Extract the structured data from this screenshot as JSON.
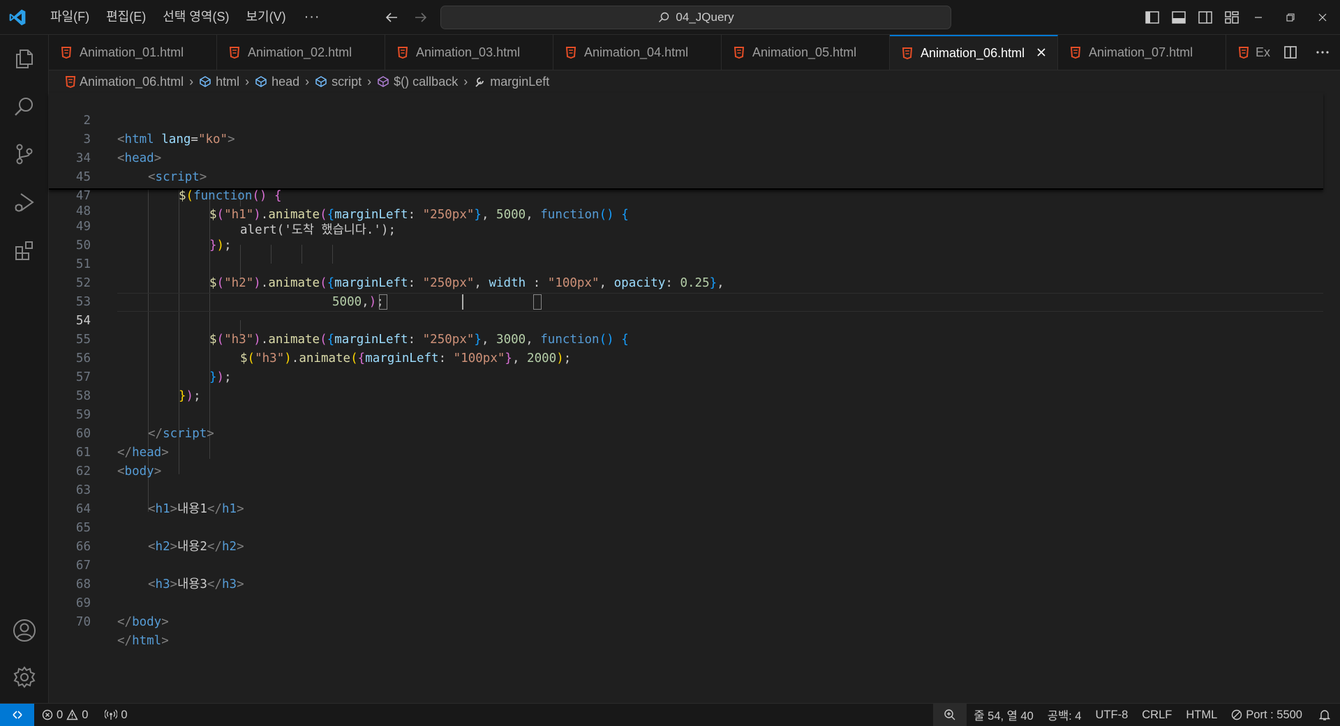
{
  "titlebar": {
    "menu": [
      "파일(F)",
      "편집(E)",
      "선택 영역(S)",
      "보기(V)"
    ],
    "more": "···",
    "search_text": "04_JQuery"
  },
  "tabs": [
    {
      "label": "Animation_01.html"
    },
    {
      "label": "Animation_02.html"
    },
    {
      "label": "Animation_03.html"
    },
    {
      "label": "Animation_04.html"
    },
    {
      "label": "Animation_05.html"
    },
    {
      "label": "Animation_06.html",
      "active": true
    },
    {
      "label": "Animation_07.html"
    }
  ],
  "tab_partial": "Ex",
  "breadcrumb": {
    "file": "Animation_06.html",
    "items": [
      "html",
      "head",
      "script",
      "$() callback",
      "marginLeft"
    ]
  },
  "sticky_lines": [
    "2",
    "3",
    "34",
    "45",
    "47"
  ],
  "line_numbers": [
    "48",
    "49",
    "50",
    "51",
    "52",
    "53",
    "54",
    "55",
    "56",
    "57",
    "58",
    "59",
    "60",
    "61",
    "62",
    "63",
    "64",
    "65",
    "66",
    "67",
    "68",
    "69",
    "70"
  ],
  "code": {
    "l2": {
      "lt": "<",
      "tag": "html",
      "attr": "lang",
      "eq": "=",
      "val": "\"ko\"",
      "gt": ">"
    },
    "l3": {
      "lt": "<",
      "tag": "head",
      "gt": ">"
    },
    "l34": {
      "lt": "<",
      "tag": "script",
      "gt": ">"
    },
    "l45": {
      "dollar": "$",
      "p1": "(",
      "kw": "function",
      "p2": "()",
      "sp": " ",
      "b": "{"
    },
    "l47": {
      "dollar": "$",
      "p1": "(",
      "sel": "\"h1\"",
      "p2": ")",
      "dot": ".",
      "fn": "animate",
      "p3": "(",
      "b1": "{",
      "prop": "marginLeft",
      "colon": ": ",
      "val": "\"250px\"",
      "b2": "}",
      "comma": ", ",
      "num": "5000",
      "comma2": ", ",
      "kw": "function",
      "p4": "()",
      "sp": " ",
      "b3": "{"
    },
    "l48": {
      "text": "alert('도착 했습니다.');"
    },
    "l49": {
      "b": "}",
      "p": ")",
      "semi": ";"
    },
    "l51": {
      "dollar": "$",
      "p1": "(",
      "sel": "\"h2\"",
      "p2": ")",
      "dot": ".",
      "fn": "animate",
      "p3": "(",
      "b1": "{",
      "prop": "marginLeft",
      "colon": ": ",
      "val": "\"250px\"",
      "comma": ", ",
      "prop2": "width",
      "colon2": " : ",
      "val2": "\"100px\"",
      "comma2": ", ",
      "prop3": "opacity",
      "colon3": ": ",
      "num3": "0.25",
      "b2": "}",
      "comma3": ","
    },
    "l52": {
      "num": "5000",
      "comma": ",",
      "p": ")",
      "semi": ";"
    },
    "l54": {
      "dollar": "$",
      "p1": "(",
      "sel": "\"h3\"",
      "p2": ")",
      "dot": ".",
      "fn": "animate",
      "p3": "(",
      "b1": "{",
      "prop": "marginLeft",
      "colon": ": ",
      "val": "\"250px\"",
      "b2": "}",
      "comma": ", ",
      "num": "3000",
      "comma2": ", ",
      "kw": "function",
      "p4": "()",
      "sp": " ",
      "b3": "{"
    },
    "l55": {
      "dollar": "$",
      "p1": "(",
      "sel": "\"h3\"",
      "p2": ")",
      "dot": ".",
      "fn": "animate",
      "p3": "(",
      "b1": "{",
      "prop": "marginLeft",
      "colon": ": ",
      "val": "\"100px\"",
      "b2": "}",
      "comma": ", ",
      "num": "2000",
      "p4": ")",
      "semi": ";"
    },
    "l56": {
      "b": "}",
      "p": ")",
      "semi": ";"
    },
    "l57": {
      "b": "}",
      "p": ")",
      "semi": ";"
    },
    "l59": {
      "lt": "</",
      "tag": "script",
      "gt": ">"
    },
    "l60": {
      "lt": "</",
      "tag": "head",
      "gt": ">"
    },
    "l61": {
      "lt": "<",
      "tag": "body",
      "gt": ">"
    },
    "l63": {
      "open_lt": "<",
      "open_tag": "h1",
      "open_gt": ">",
      "text": "내용1",
      "close_lt": "</",
      "close_tag": "h1",
      "close_gt": ">"
    },
    "l65": {
      "open_lt": "<",
      "open_tag": "h2",
      "open_gt": ">",
      "text": "내용2",
      "close_lt": "</",
      "close_tag": "h2",
      "close_gt": ">"
    },
    "l67": {
      "open_lt": "<",
      "open_tag": "h3",
      "open_gt": ">",
      "text": "내용3",
      "close_lt": "</",
      "close_tag": "h3",
      "close_gt": ">"
    },
    "l69": {
      "lt": "</",
      "tag": "body",
      "gt": ">"
    },
    "l70": {
      "lt": "</",
      "tag": "html",
      "gt": ">"
    }
  },
  "statusbar": {
    "errors": "0",
    "warnings": "0",
    "ports": "0",
    "position": "줄 54, 열 40",
    "spaces": "공백: 4",
    "encoding": "UTF-8",
    "eol": "CRLF",
    "language": "HTML",
    "port": "Port : 5500"
  },
  "colors": {
    "accent": "#0078d4",
    "html_icon": "#e44d26",
    "background": "#1f1f1f"
  }
}
